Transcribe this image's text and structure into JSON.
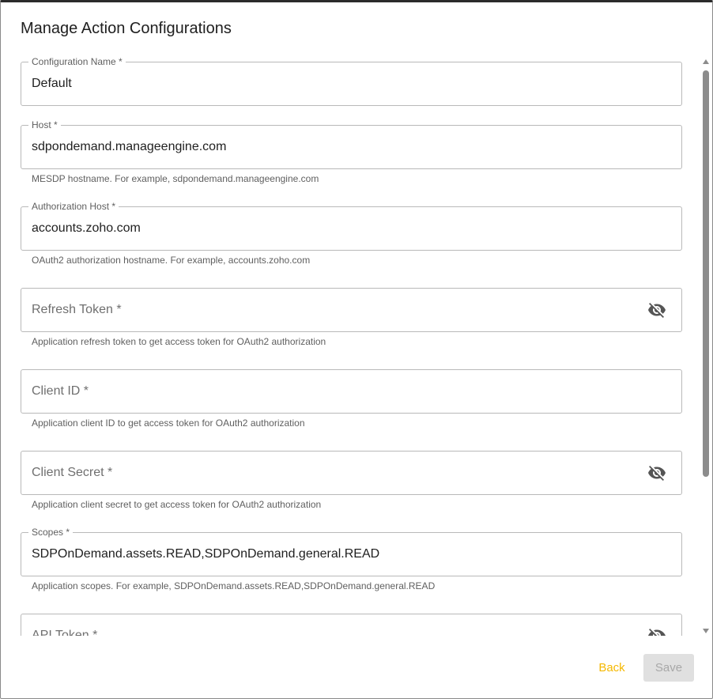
{
  "dialog": {
    "title": "Manage Action Configurations"
  },
  "fields": {
    "config_name": {
      "label": "Configuration Name *",
      "value": "Default"
    },
    "host": {
      "label": "Host *",
      "value": "sdpondemand.manageengine.com",
      "helper": "MESDP hostname. For example, sdpondemand.manageengine.com"
    },
    "auth_host": {
      "label": "Authorization Host *",
      "value": "accounts.zoho.com",
      "helper": "OAuth2 authorization hostname. For example, accounts.zoho.com"
    },
    "refresh_token": {
      "placeholder": "Refresh Token *",
      "helper": "Application refresh token to get access token for OAuth2 authorization",
      "icon": "eye-off-icon"
    },
    "client_id": {
      "placeholder": "Client ID *",
      "helper": "Application client ID to get access token for OAuth2 authorization"
    },
    "client_secret": {
      "placeholder": "Client Secret *",
      "helper": "Application client secret to get access token for OAuth2 authorization",
      "icon": "eye-off-icon"
    },
    "scopes": {
      "label": "Scopes *",
      "value": "SDPOnDemand.assets.READ,SDPOnDemand.general.READ",
      "helper": "Application scopes. For example, SDPOnDemand.assets.READ,SDPOnDemand.general.READ"
    },
    "api_token": {
      "placeholder": "API Token *",
      "icon": "eye-off-icon"
    }
  },
  "actions": {
    "back_label": "Back",
    "save_label": "Save"
  },
  "colors": {
    "accent": "#f5b800",
    "border": "#b9b9b9",
    "disabled_bg": "#e0e0e0"
  }
}
